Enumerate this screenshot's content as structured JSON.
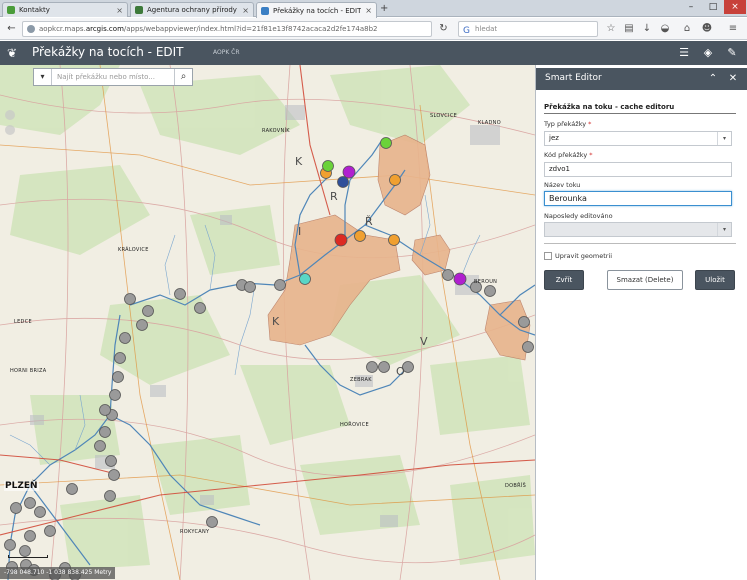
{
  "browser": {
    "tabs": [
      {
        "label": "Kontakty",
        "color": "#4a9c3a"
      },
      {
        "label": "Agentura ochrany přírody ...",
        "color": "#3d7a3a"
      },
      {
        "label": "Překážky na tocích - EDIT",
        "color": "#3b7fc4"
      }
    ],
    "new_tab_label": "+",
    "url_prefix": "aopkcr.maps.",
    "url_host": "arcgis.com",
    "url_rest": "/apps/webappviewer/index.html?id=21f81e13f8742acaca2d2fe174a8b2",
    "search_placeholder": "hledat",
    "search_engine_glyph": "G"
  },
  "app": {
    "title": "Překážky na tocích - EDIT",
    "subtitle": "AOPK ČR"
  },
  "map": {
    "search_placeholder": "Najít překážku nebo místo...",
    "coordinates": "-798 048.710 -1 038 838.425 Metry",
    "city_label": "PLZEŇ",
    "place_labels": [
      "KLADNO",
      "SLOVCICE",
      "RAKOVNÍK",
      "BEROUN",
      "KRÁLOVICE",
      "LEDCE",
      "ZEBRAK",
      "HORAZDOVICE",
      "ROKYCANY",
      "HORNI BRIZA",
      "HOŘOVICE",
      "DOBŘÍŠ"
    ],
    "big_letters": [
      "K",
      "R",
      "Ř",
      "I",
      "V",
      "O",
      "K"
    ],
    "colors": {
      "protected_area": "#e8b48c",
      "river": "#4f86b8",
      "point_gray": "#9a9a9a",
      "point_orange": "#f0a030",
      "point_green": "#6bd23a",
      "point_purple": "#b01fcf",
      "point_blue": "#2f4f9a",
      "point_red": "#dd2a22",
      "point_cyan": "#59d6c6"
    }
  },
  "editor": {
    "panel_title": "Smart Editor",
    "form_title": "Překážka na toku - cache editoru",
    "fields": {
      "type_label": "Typ překážky",
      "type_value": "jez",
      "code_label": "Kód překážky",
      "code_value": "zdvo1",
      "river_label": "Název toku",
      "river_value": "Berounka",
      "last_edited_label": "Naposledy editováno",
      "last_edited_value": ""
    },
    "required_mark": "*",
    "geometry_checkbox_label": "Upravit geometrii",
    "buttons": {
      "close": "Zvřít",
      "delete": "Smazat (Delete)",
      "save": "Uložit"
    }
  }
}
